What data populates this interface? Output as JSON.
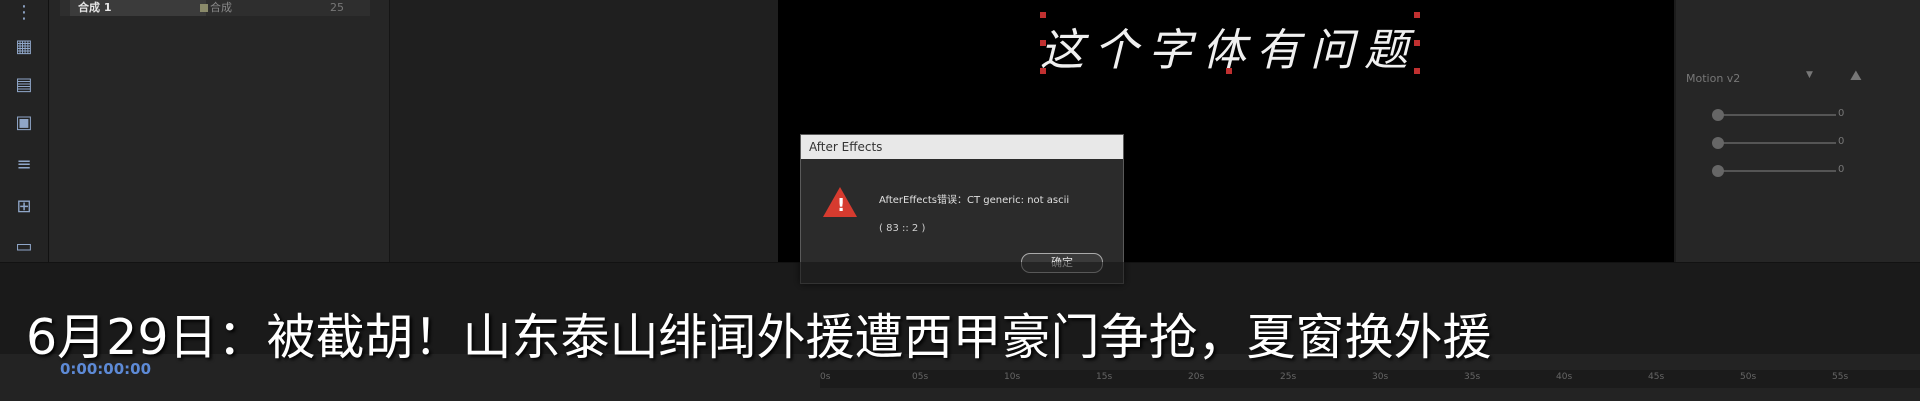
{
  "project": {
    "item_name": "合成 1",
    "item_type": "合成",
    "item_count": "25"
  },
  "viewer": {
    "overlay_text": "这个字体有问题"
  },
  "dialog": {
    "title": "After Effects",
    "message": "AfterEffects错误：CT generic: not ascii",
    "code": "( 83 :: 2 )",
    "ok_label": "确定",
    "icon": "warning-icon"
  },
  "right_panel": {
    "preset_label": "Motion v2",
    "slider_values": [
      "0",
      "0",
      "0"
    ]
  },
  "timeline": {
    "timecode": "0:00:00:00",
    "ruler_ticks": [
      "0s",
      "05s",
      "10s",
      "15s",
      "20s",
      "25s",
      "30s",
      "35s",
      "40s",
      "45s",
      "50s",
      "55s"
    ]
  },
  "subtitle": {
    "text": "6月29日：被截胡！山东泰山绯闻外援遭西甲豪门争抢，夏窗换外援"
  },
  "colors": {
    "accent_blue": "#5d8ad6",
    "warning_red": "#d63b2f",
    "handle_red": "#c03030"
  }
}
